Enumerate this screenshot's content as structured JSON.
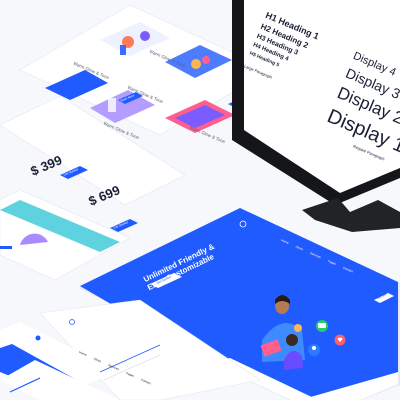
{
  "colors": {
    "accent": "#1f5bff",
    "text": "#1a1f36",
    "bg": "#f7f8fb",
    "monitor": "#15161a"
  },
  "cards": {
    "top_left": [
      "Warm Glow & Tone",
      "Warm Glow & Tone",
      "Warm Glow & Tone"
    ],
    "top_right": [
      "Warm Glow & Tone",
      "Warm Glow & Tone"
    ],
    "button": "Read More"
  },
  "pricing": {
    "plans": [
      {
        "price": "$ 399"
      },
      {
        "price": "$ 699"
      }
    ],
    "button": "Get Started"
  },
  "typography": {
    "headings": [
      "H1 Heading 1",
      "H2 Heading 2",
      "H3 Heading 3",
      "H4 Heading 4",
      "H5 Heading 5"
    ],
    "large_paragraph": "Large Paragraph",
    "regular_paragraph": "Regular Paragraph",
    "displays": [
      "Display 4",
      "Display 3",
      "Display 2",
      "Display 1"
    ]
  },
  "hero": {
    "title_line1": "Unlimited Friendly &",
    "title_line2": "Easy Customizable",
    "cta": "Get Started",
    "nav": [
      "Home",
      "About",
      "Services",
      "Pages",
      "Contact"
    ],
    "nav_button": "Buy Now"
  },
  "footer_nav": [
    "Home",
    "About",
    "Services",
    "Pages",
    "Contact"
  ]
}
